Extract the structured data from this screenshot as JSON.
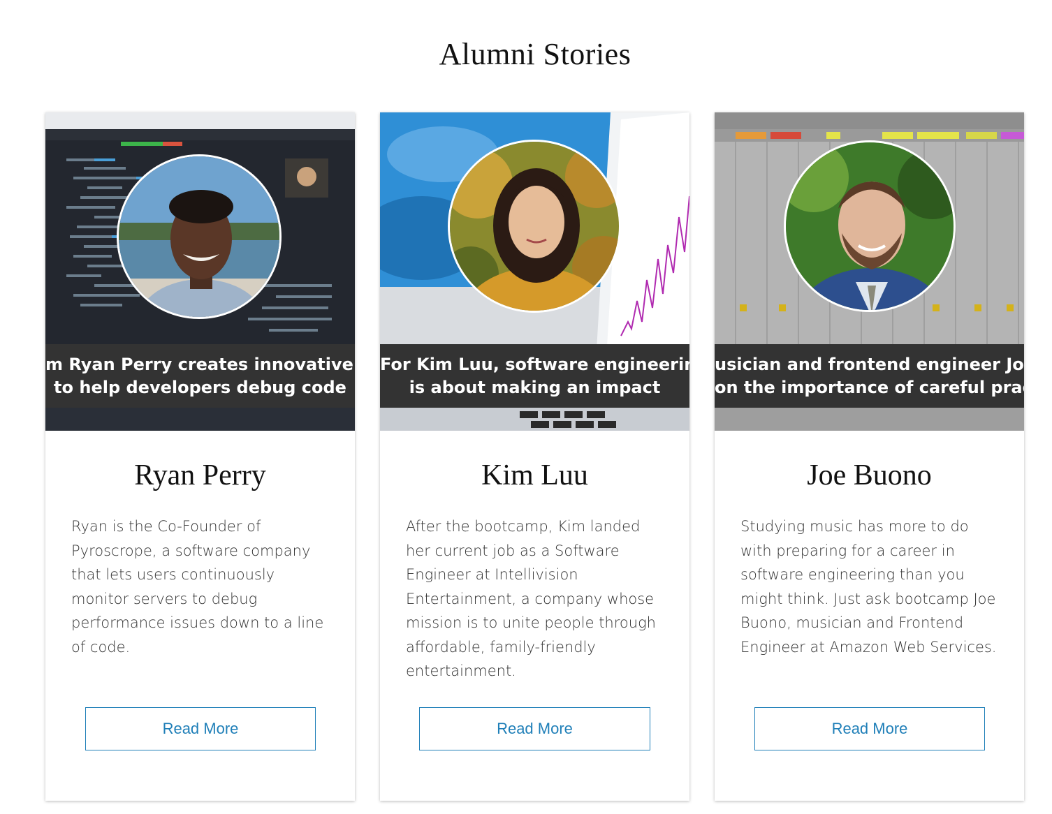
{
  "page": {
    "title": "Alumni Stories"
  },
  "colors": {
    "accent": "#1f7fb8",
    "caption_band": "#333333",
    "card_bg": "#ffffff"
  },
  "cards": [
    {
      "caption_line1": "m Ryan Perry creates innovative softw",
      "caption_line2": "to help developers debug code",
      "name": "Ryan Perry",
      "description": "Ryan is the Co-Founder of Pyroscrope, a software company that lets users continuously monitor servers to debug performance issues down to a line of code.",
      "button_label": "Read More",
      "hero_image": "laptop-code-editor-photo",
      "avatar_image": "ryan-perry-portrait"
    },
    {
      "caption_line1": "For Kim Luu, software engineering",
      "caption_line2": "is about making an impact",
      "name": "Kim Luu",
      "description": "After the bootcamp, Kim landed her current job as a Software Engineer at Intellivision Entertainment, a company whose mission is to unite people through affordable, family-friendly entertainment.",
      "button_label": "Read More",
      "hero_image": "laptop-chart-photo",
      "avatar_image": "kim-luu-portrait"
    },
    {
      "caption_line1": "usician and frontend engineer Joe Buo",
      "caption_line2": "on the importance of careful practice",
      "name": "Joe Buono",
      "description": "Studying music has more to do with preparing for a career in software engineering than you might think. Just ask bootcamp Joe Buono, musician and Frontend Engineer at Amazon Web Services.",
      "button_label": "Read More",
      "hero_image": "music-mixer-software-photo",
      "avatar_image": "joe-buono-portrait"
    }
  ]
}
